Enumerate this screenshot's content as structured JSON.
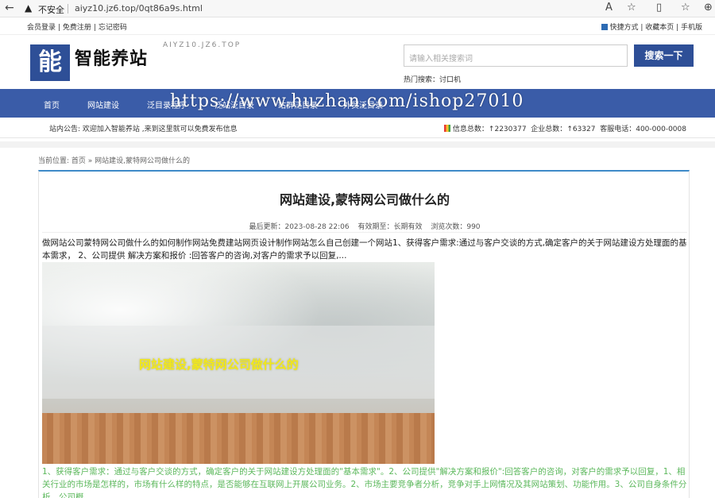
{
  "browser": {
    "insecure_label": "不安全",
    "url": "aiyz10.jz6.top/0qt86a9s.html"
  },
  "topbar": {
    "links": [
      "会员登录",
      "免费注册",
      "忘记密码"
    ],
    "right": "快捷方式 | 收藏本页 | 手机版"
  },
  "header": {
    "logo_char": "能",
    "site_name": "智能养站",
    "domain": "AIYZ10.JZ6.TOP",
    "search_placeholder": "请输入相关搜索词",
    "search_button": "搜索一下",
    "hot_search": "热门搜索：讨口机"
  },
  "nav": {
    "items": [
      "首页",
      "网站建设",
      "泛目录程序",
      "泛站泛目录",
      "站群泛目录",
      "外贸泛目录"
    ],
    "watermark": "https://www.huzhan.com/ishop27010"
  },
  "notice": {
    "left": "站内公告: 欢迎加入智能养站 ,来到这里就可以免费发布信息",
    "info_total": "信息总数：",
    "info_count": "2230377",
    "company_total": "企业总数：",
    "company_count": "63327",
    "phone": "客服电话：400-000-0008"
  },
  "breadcrumb": "当前位置: 首页 » 网站建设,蒙特网公司做什么的",
  "article": {
    "title": "网站建设,蒙特网公司做什么的",
    "meta": {
      "updated": "最后更新：2023-08-28 22:06",
      "validity": "有效期至：长期有效",
      "views": "浏览次数：990"
    },
    "summary": "做网站公司蒙特网公司做什么的如何制作网站免费建站网页设计制作网站怎么自己创建一个网站1、获得客户需求:通过与客户交谈的方式,确定客户的关于网站建设方处理面的基本需求， 2、公司提供 解决方案和报价 :回答客户的咨询,对客户的需求予以回复,...",
    "hero_text": "网站建设,蒙特网公司做什么的",
    "body": "1、获得客户需求：通过与客户交谈的方式，确定客户的关于网站建设方处理面的\"基本需求\"。2、公司提供\"解决方案和报价\":回答客户的咨询，对客户的需求予以回复，1、相关行业的市场是怎样的，市场有什么样的特点，是否能够在互联网上开展公司业务。2、市场主要竞争者分析，竞争对手上网情况及其网站策划、功能作用。3、公司自身条件分析，公司概"
  }
}
